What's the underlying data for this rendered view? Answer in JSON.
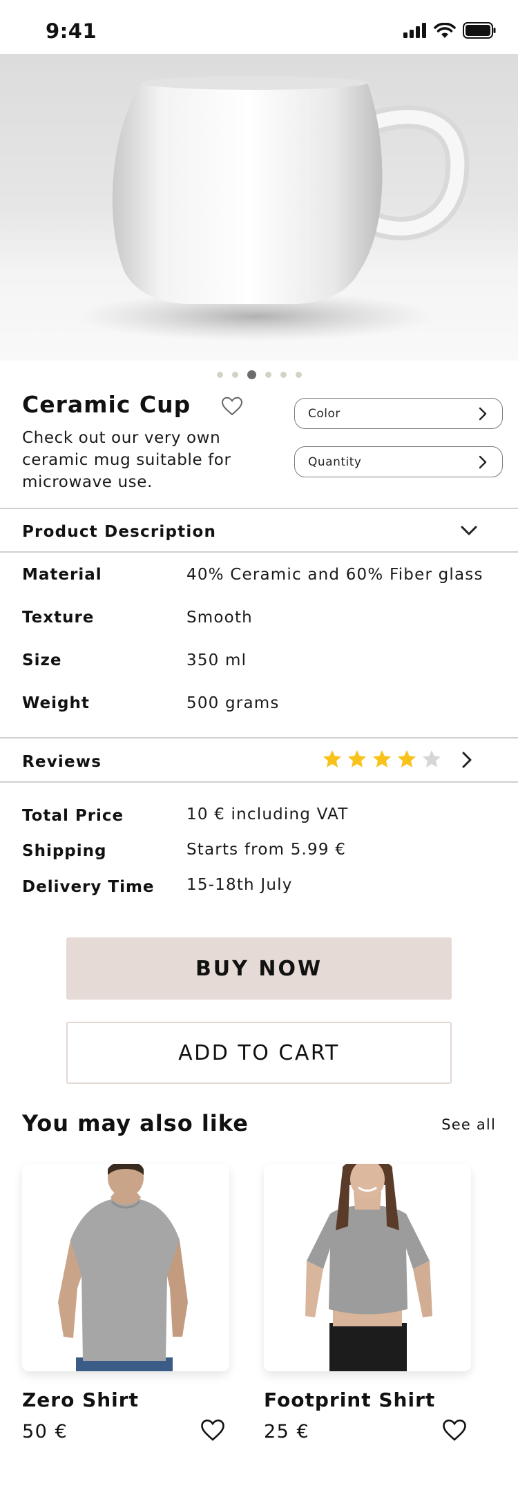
{
  "status_bar": {
    "time": "9:41"
  },
  "hero": {
    "pages": 6,
    "active_page": 3
  },
  "product": {
    "title": "Ceramic Cup",
    "description": "Check out our very own ceramic mug suitable for microwave use.",
    "color_label": "Color",
    "quantity_label": "Quantity"
  },
  "description_section": {
    "heading": "Product Description"
  },
  "specs": [
    {
      "label": "Material",
      "value": "40% Ceramic and 60% Fiber glass"
    },
    {
      "label": "Texture",
      "value": "Smooth"
    },
    {
      "label": "Size",
      "value": "350 ml"
    },
    {
      "label": "Weight",
      "value": "500 grams"
    }
  ],
  "reviews": {
    "heading": "Reviews",
    "rating": 4,
    "max": 5,
    "star_color": "#F8C21B",
    "empty_star_color": "#D6D6D6"
  },
  "pricing": [
    {
      "label": "Total Price",
      "value": "10 € including VAT"
    },
    {
      "label": "Shipping",
      "value": "Starts  from 5.99 €"
    },
    {
      "label": "Delivery Time",
      "value": "15-18th July"
    }
  ],
  "actions": {
    "buy_label": "BUY NOW",
    "cart_label": "ADD TO CART",
    "buy_color": "#E5DAD5"
  },
  "recommendations": {
    "heading": "You may also like",
    "see_all": "See all",
    "items": [
      {
        "name": "Zero Shirt",
        "price": "50 €"
      },
      {
        "name": "Footprint Shirt",
        "price": "25 €"
      }
    ]
  }
}
